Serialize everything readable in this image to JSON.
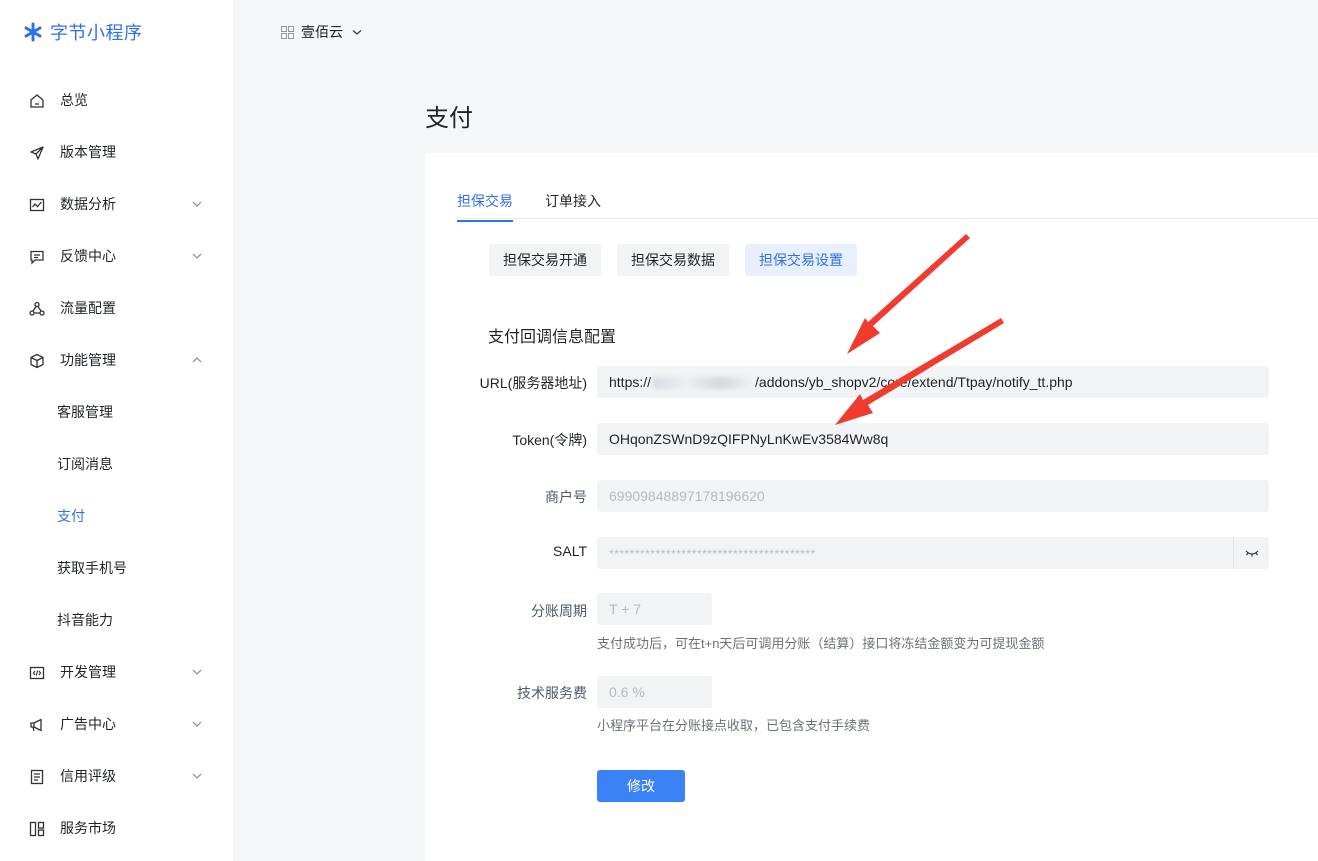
{
  "brand": {
    "name": "字节小程序",
    "color": "#2f6fec"
  },
  "topbar": {
    "app_name": "壹佰云"
  },
  "sidebar": {
    "items": [
      {
        "label": "总览",
        "icon": "home-icon"
      },
      {
        "label": "版本管理",
        "icon": "send-icon"
      },
      {
        "label": "数据分析",
        "icon": "chart-icon"
      },
      {
        "label": "反馈中心",
        "icon": "message-icon"
      },
      {
        "label": "流量配置",
        "icon": "share-icon"
      },
      {
        "label": "功能管理",
        "icon": "cube-icon"
      },
      {
        "label": "客服管理"
      },
      {
        "label": "订阅消息"
      },
      {
        "label": "支付"
      },
      {
        "label": "获取手机号"
      },
      {
        "label": "抖音能力"
      },
      {
        "label": "开发管理",
        "icon": "code-icon"
      },
      {
        "label": "广告中心",
        "icon": "megaphone-icon"
      },
      {
        "label": "信用评级",
        "icon": "document-icon"
      },
      {
        "label": "服务市场",
        "icon": "grid-icon"
      }
    ]
  },
  "page": {
    "title": "支付"
  },
  "tabs": [
    {
      "label": "担保交易"
    },
    {
      "label": "订单接入"
    }
  ],
  "subtabs": [
    {
      "label": "担保交易开通"
    },
    {
      "label": "担保交易数据"
    },
    {
      "label": "担保交易设置"
    }
  ],
  "form": {
    "section_title": "支付回调信息配置",
    "url": {
      "label": "URL(服务器地址)",
      "prefix": "https://",
      "suffix": "/addons/yb_shopv2/core/extend/Ttpay/notify_tt.php"
    },
    "token": {
      "label": "Token(令牌)",
      "value": "OHqonZSWnD9zQIFPNyLnKwEv3584Ww8q"
    },
    "merchant": {
      "label": "商户号",
      "value": "69909848897178196620"
    },
    "salt": {
      "label": "SALT",
      "value": "****************************************"
    },
    "settle": {
      "label": "分账周期",
      "value": "T + 7",
      "hint": "支付成功后，可在t+n天后可调用分账（结算）接口将冻结金额变为可提现金额"
    },
    "fee": {
      "label": "技术服务费",
      "value": "0.6 %",
      "hint": "小程序平台在分账接点收取，已包含支付手续费"
    },
    "submit": "修改"
  },
  "colors": {
    "accent": "#2f6fec",
    "button": "#3a82f6",
    "annotation": "#f03c2e"
  }
}
